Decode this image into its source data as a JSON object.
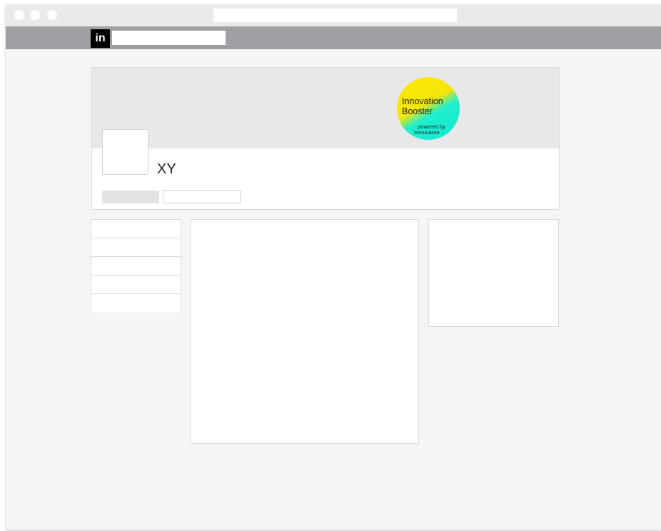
{
  "browser": {
    "address_bar": "",
    "window_controls": [
      "close-dot",
      "minimize-dot",
      "zoom-dot"
    ]
  },
  "navbar": {
    "logo_text": "in",
    "search_value": ""
  },
  "profile": {
    "name": "XY",
    "badge": {
      "line1": "Innovation",
      "line2": "Booster",
      "line3": "powered by",
      "line4": "Innosuisse"
    },
    "primary_button_label": "",
    "secondary_button_label": ""
  },
  "sidebar": {
    "items": [
      {
        "label": ""
      },
      {
        "label": ""
      },
      {
        "label": ""
      },
      {
        "label": ""
      },
      {
        "label": ""
      }
    ]
  },
  "feed": {
    "content": ""
  },
  "right_panel": {
    "content": ""
  },
  "colors": {
    "navbar": "#9fa0a3",
    "titlebar": "#e9eaea",
    "page_bg": "#f4f5f4",
    "cover": "#e8e8e8",
    "badge_yellow": "#ffe600",
    "badge_cyan": "#0fe8d6"
  }
}
